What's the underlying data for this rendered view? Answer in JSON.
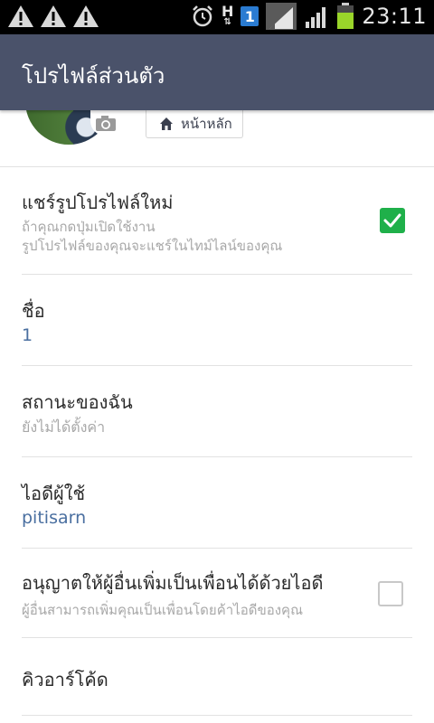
{
  "status_bar": {
    "time": "23:11",
    "notification_badge": "1",
    "network_type": "H",
    "icons": [
      "warning-icon",
      "warning-icon",
      "warning-icon",
      "alarm-icon",
      "data-arrows-icon",
      "signal-icon",
      "signal-icon",
      "battery-icon"
    ]
  },
  "header": {
    "title": "โปรไฟล์ส่วนตัว"
  },
  "profile": {
    "home_button_label": "หน้าหลัก"
  },
  "settings": {
    "share_profile": {
      "label": "แชร์รูปโปรไฟล์ใหม่",
      "description_line1": "ถ้าคุณกดปุ่มเปิดใช้งาน",
      "description_line2": "รูปโปรไฟล์ของคุณจะแชร์ในไทม์ไลน์ของคุณ",
      "checked": true
    },
    "name": {
      "label": "ชื่อ",
      "value": "1"
    },
    "status_message": {
      "label": "สถานะของฉัน",
      "value": "ยังไม่ได้ตั้งค่า"
    },
    "user_id": {
      "label": "ไอดีผู้ใช้",
      "value": "pitisarn"
    },
    "allow_add_by_id": {
      "label": "อนุญาตให้ผู้อื่นเพิ่มเป็นเพื่อนได้ด้วยไอดี",
      "description": "ผู้อื่นสามารถเพิ่มคุณเป็นเพื่อนโดยค้าไอดีของคุณ",
      "checked": false
    },
    "qr_code": {
      "label": "คิวอาร์โค้ด"
    }
  },
  "colors": {
    "title_bar": "#4a526a",
    "checkbox_on": "#1fb04a",
    "value_text": "#4a6fa0"
  }
}
